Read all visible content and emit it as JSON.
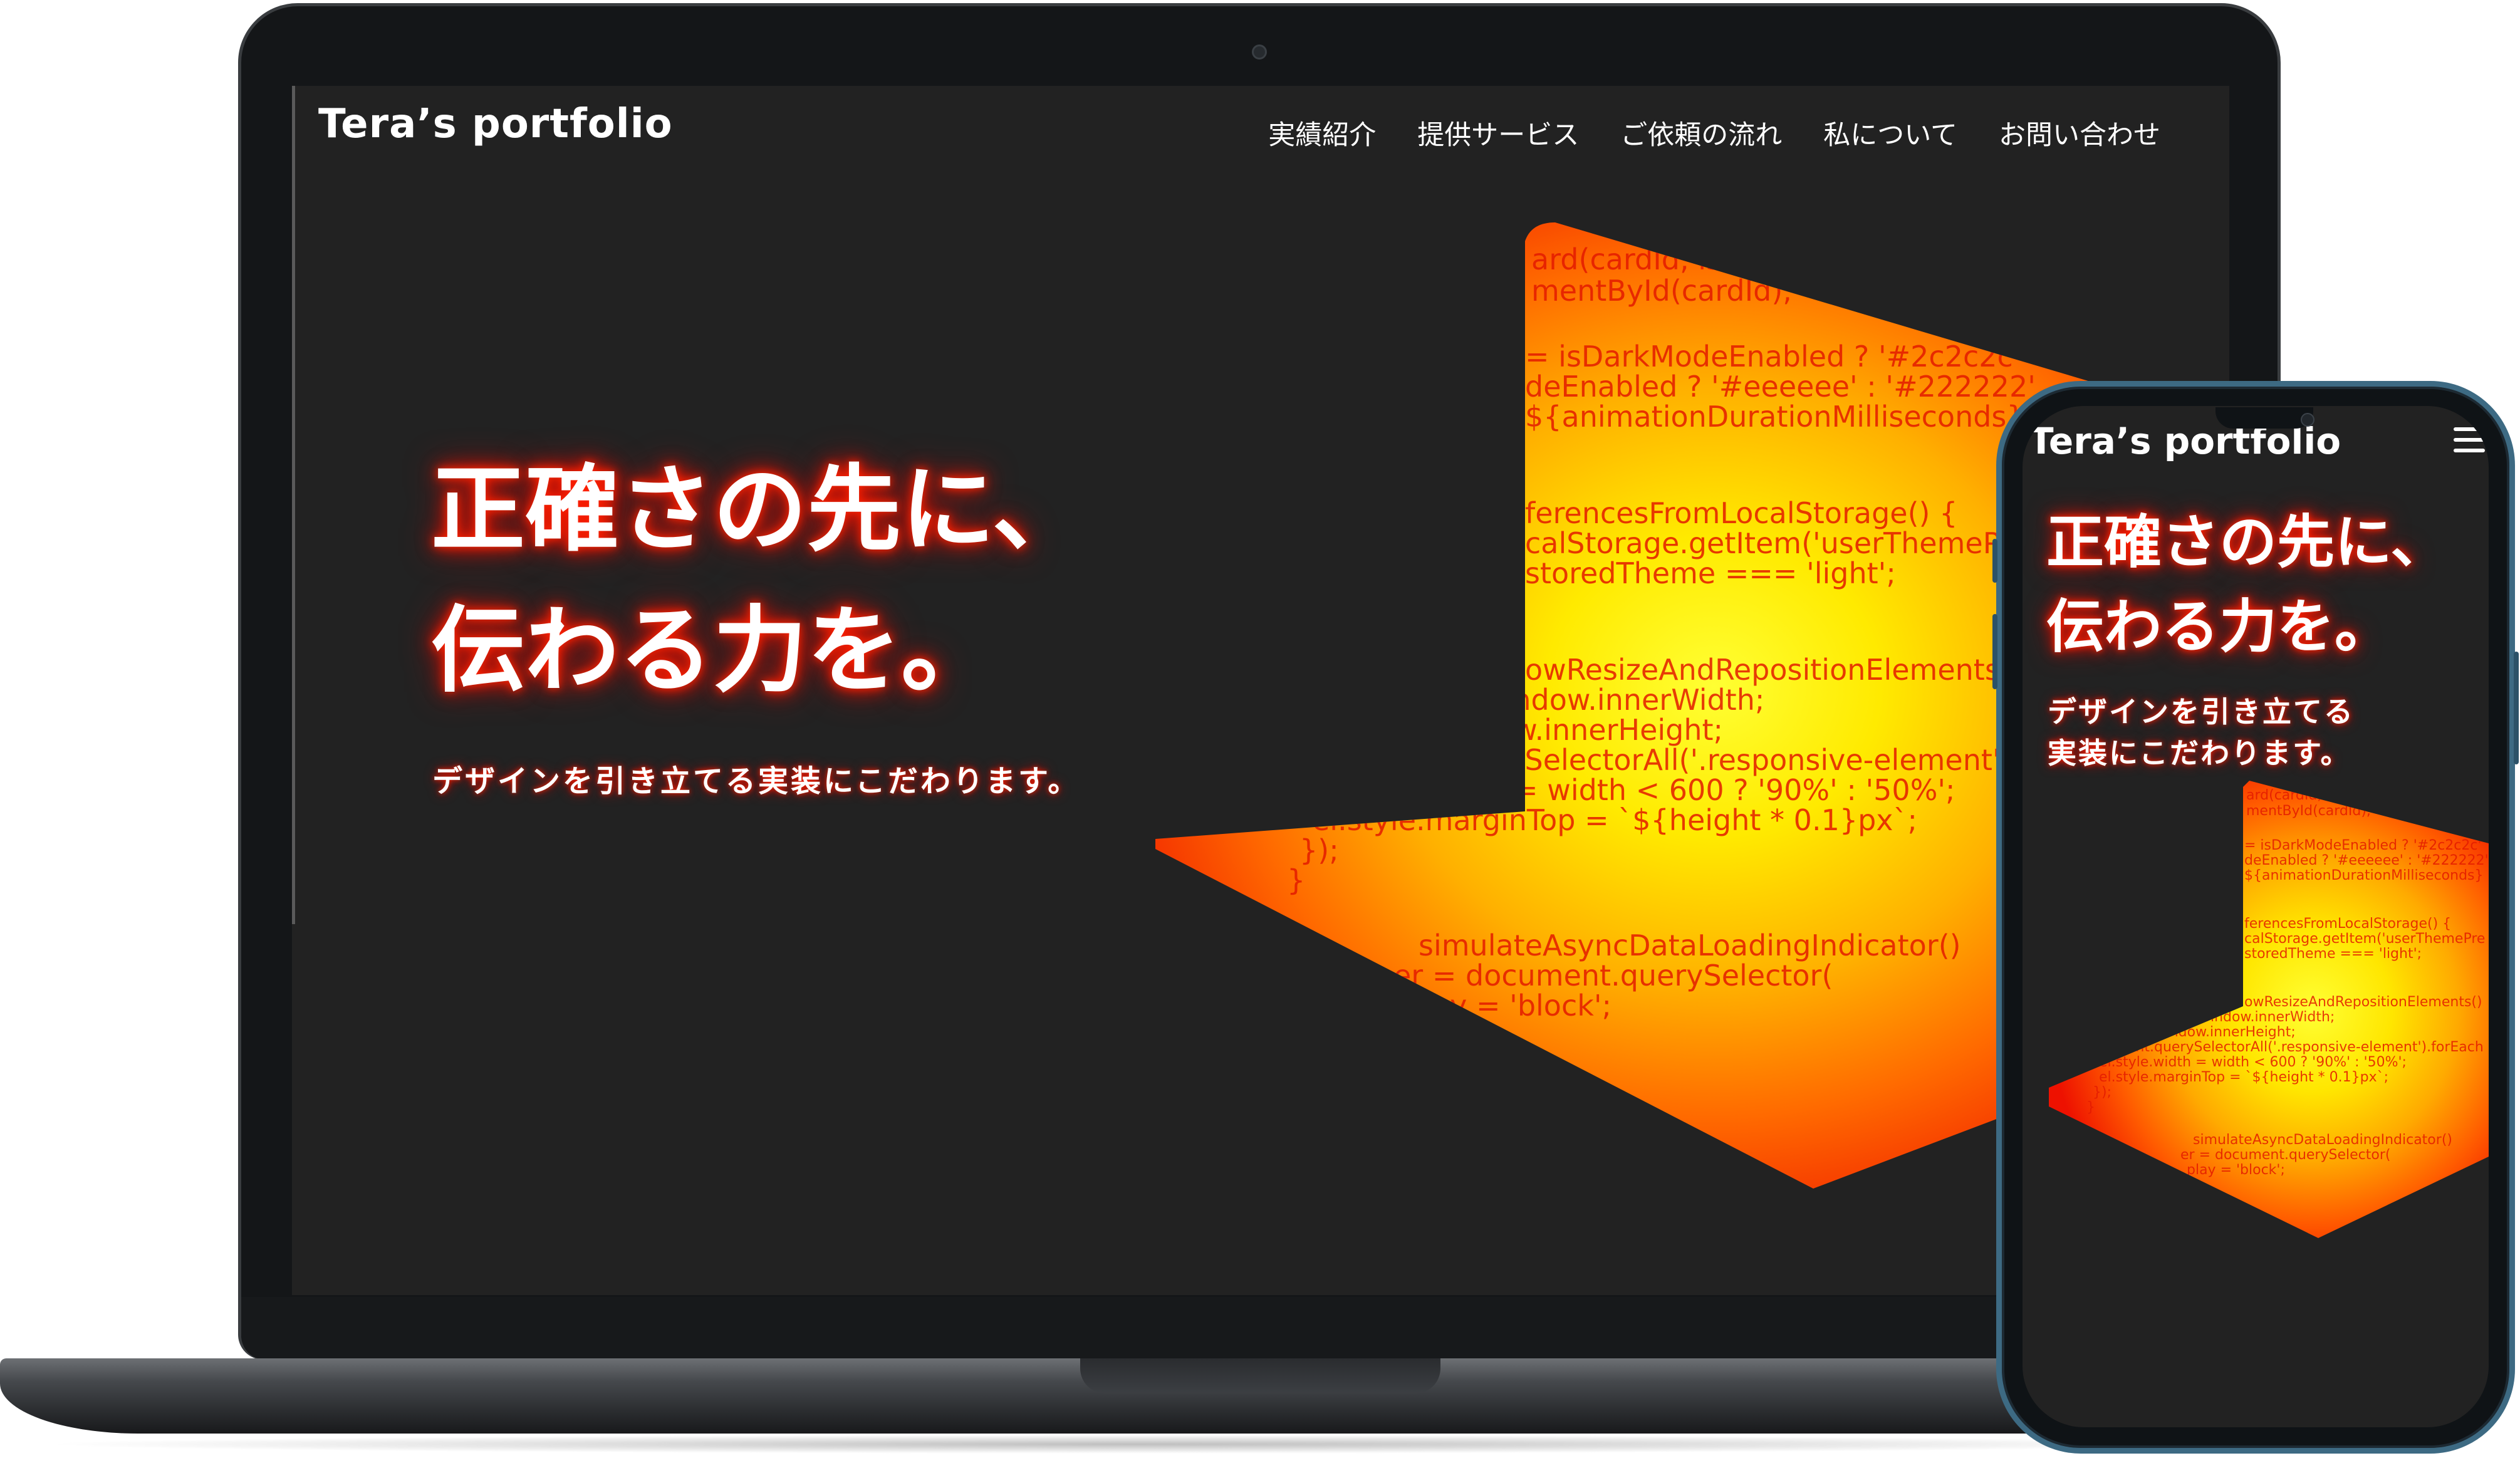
{
  "site": {
    "brand": "Tera’s portfolio",
    "nav": [
      "実績紹介",
      "提供サービス",
      "ご依頼の流れ",
      "私について",
      "お問い合わせ"
    ],
    "headline": [
      "正確さの先に、",
      "伝わる力を。"
    ],
    "subtitle": "デザインを引き立てる実装にこだわります。",
    "subtitle_mobile": [
      "デザインを引き立てる",
      "実装にこだわります。"
    ],
    "code_lines": [
      "ard(cardId, is",
      "mentById(cardId);",
      "= isDarkModeEnabled ? '#2c2c2c'",
      "deEnabled ? '#eeeeee' : '#222222'",
      "${animationDurationMilliseconds}",
      "ferencesFromLocalStorage() {",
      "calStorage.getItem('userThemePre",
      "storedTheme === 'light';",
      "owResizeAndRepositionElements()",
      "window.innerWidth;",
      "eight = window.innerHeight;",
      "document.querySelectorAll('.responsive-element').forEach",
      "el.style.width = width < 600 ? '90%' : '50%';",
      "el.style.marginTop = `${height * 0.1}px`;",
      "});",
      "}",
      "simulateAsyncDataLoadingIndicator()",
      "er = document.querySelector(",
      "play = 'block';"
    ]
  },
  "colors": {
    "background": "#222222",
    "text": "#ffffff",
    "glow": "#ff2200",
    "art_yellow": "#ffee00",
    "art_orange": "#ff9900",
    "art_red": "#ee1100",
    "device_dark": "#141618",
    "phone_accent": "#3d6a83"
  },
  "icons": {
    "menu": "hamburger-menu-icon",
    "camera": "camera-dot"
  }
}
